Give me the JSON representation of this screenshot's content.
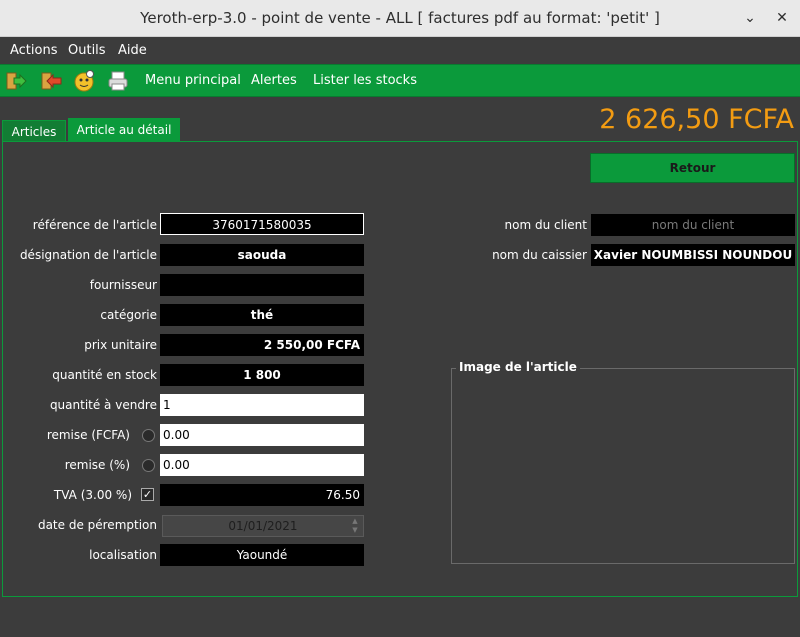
{
  "window": {
    "title": "Yeroth-erp-3.0 - point de vente - ALL  [ factures pdf au format: 'petit' ]",
    "minimize_glyph": "⌄",
    "close_glyph": "✕"
  },
  "menu": {
    "actions": "Actions",
    "outils": "Outils",
    "aide": "Aide"
  },
  "toolbar": {
    "icons": [
      "enter-icon",
      "exit-icon",
      "help-face-icon",
      "printer-icon"
    ],
    "links": [
      "Menu principal",
      "Alertes",
      "Lister les stocks"
    ]
  },
  "total": "2 626,50 FCFA",
  "tabs": [
    "Articles",
    "Article au détail"
  ],
  "retour_label": "Retour",
  "form": {
    "reference": {
      "label": "référence de l'article",
      "value": "3760171580035"
    },
    "designation": {
      "label": "désignation de l'article",
      "value": "saouda"
    },
    "fournisseur": {
      "label": "fournisseur",
      "value": ""
    },
    "categorie": {
      "label": "catégorie",
      "value": "thé"
    },
    "prix": {
      "label": "prix unitaire",
      "value": "2 550,00 FCFA"
    },
    "stock": {
      "label": "quantité en stock",
      "value": "1 800"
    },
    "quantite": {
      "label": "quantité à vendre",
      "value": "1"
    },
    "remise_fcfa": {
      "label": "remise (FCFA)",
      "value": "0.00"
    },
    "remise_pct": {
      "label": "remise (%)",
      "value": "0.00"
    },
    "tva": {
      "label": "TVA (3.00 %)",
      "value": "76.50",
      "checked": true,
      "check_glyph": "✓"
    },
    "peremption": {
      "label": "date de péremption",
      "value": "01/01/2021"
    },
    "localisation": {
      "label": "localisation",
      "value": "Yaoundé"
    }
  },
  "client": {
    "label": "nom du client",
    "placeholder": "nom du client",
    "value": ""
  },
  "caissier": {
    "label": "nom du caissier",
    "value": "Xavier NOUMBISSI NOUNDOU"
  },
  "image_box_title": "Image de l'article",
  "colors": {
    "accent_green": "#0b9a3b",
    "total_orange": "#f39c12",
    "background": "#3c3c3c"
  }
}
